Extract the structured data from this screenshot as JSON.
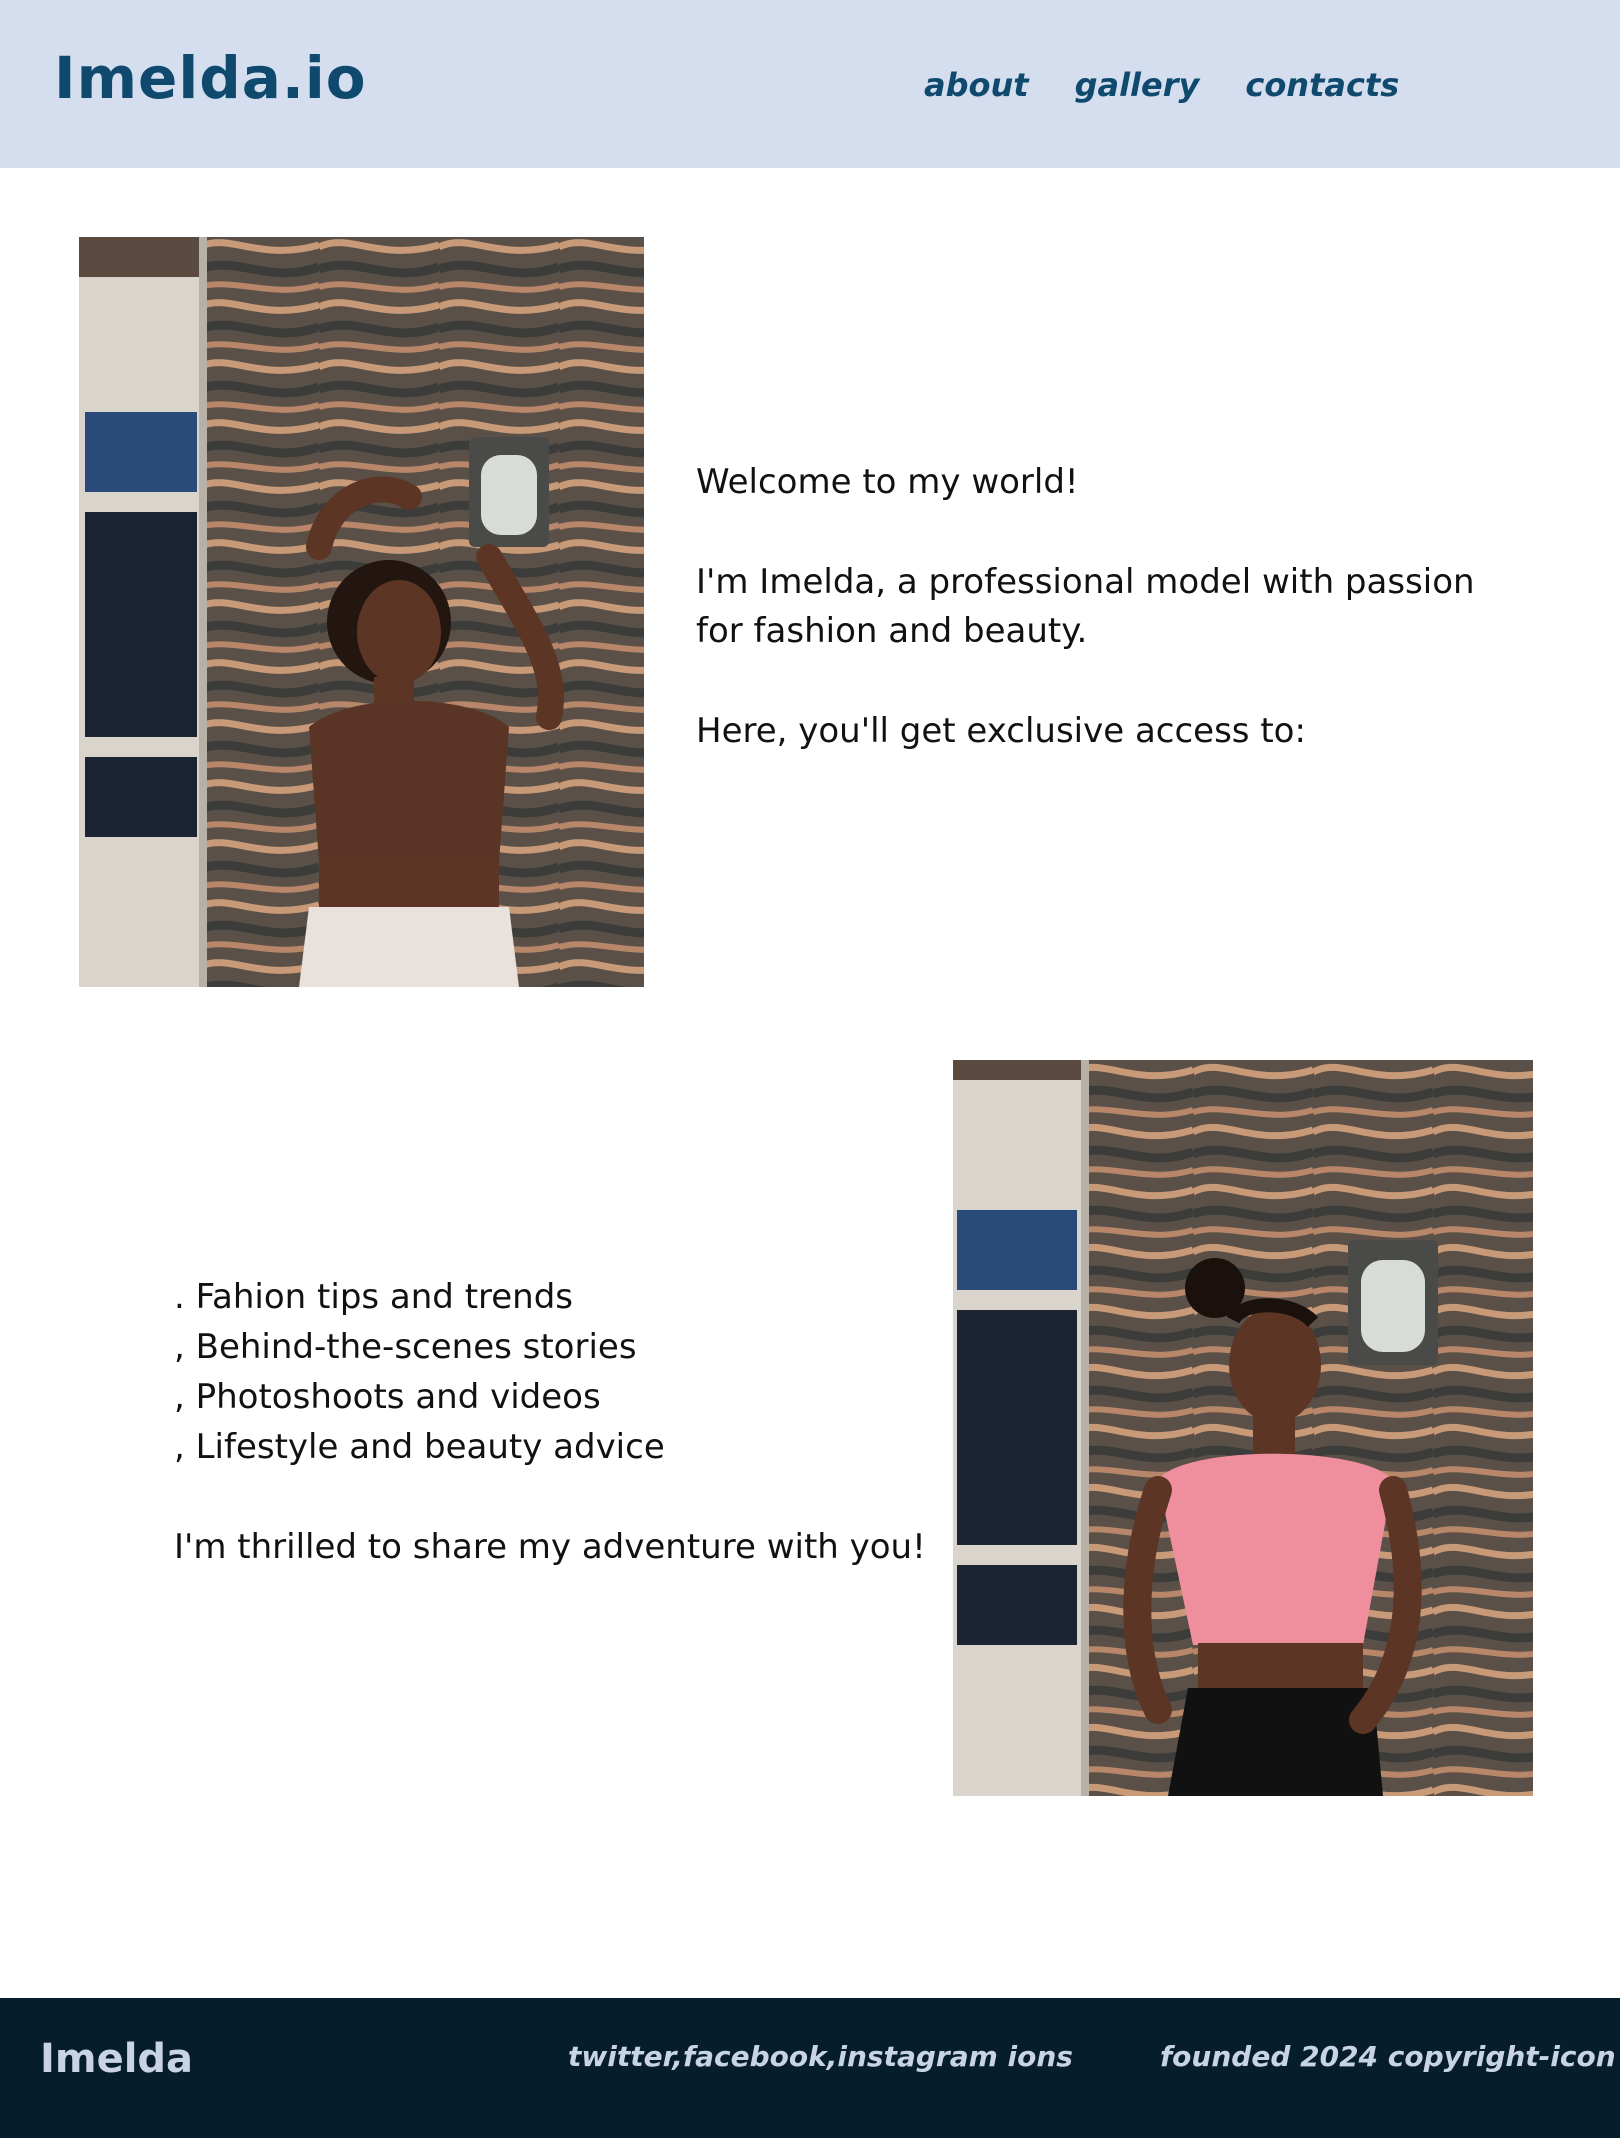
{
  "header": {
    "logo": "Imelda.io",
    "nav": [
      "about",
      "gallery",
      "contacts"
    ]
  },
  "intro": {
    "welcome": "Welcome to my world!",
    "bio": "I'm Imelda, a professional model with passion for fashion and beauty.",
    "access": "Here, you'll get exclusive access to:"
  },
  "list": {
    "items": [
      ". Fahion tips and trends",
      ", Behind-the-scenes stories",
      ", Photoshoots and videos",
      ", Lifestyle and beauty advice"
    ],
    "closing": "I'm thrilled to share my adventure with you!"
  },
  "footer": {
    "brand": "Imelda",
    "social": "twitter,facebook,instagram ions",
    "copyright": "founded 2024 copyright-icon"
  },
  "colors": {
    "header_bg": "#d5deef",
    "brand_blue": "#0f4a6e",
    "footer_bg": "#061d2d",
    "footer_text": "#c9d3e6"
  },
  "images": [
    {
      "name": "model-photo-brown-top",
      "shows": "woman in brown crop top posing against marble wall with lamp"
    },
    {
      "name": "model-photo-pink-top",
      "shows": "woman in pink crop top posing against marble wall with lamp"
    }
  ]
}
